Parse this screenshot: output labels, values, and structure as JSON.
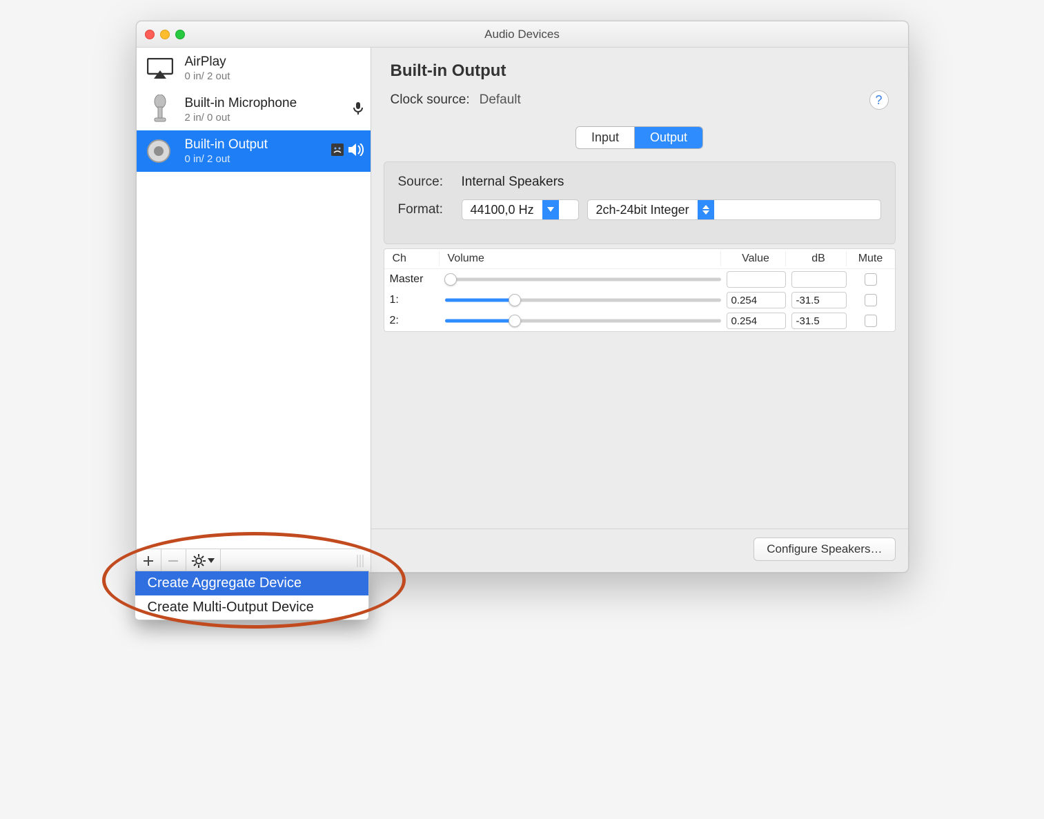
{
  "window": {
    "title": "Audio Devices"
  },
  "sidebar": {
    "devices": [
      {
        "name": "AirPlay",
        "sub": "0 in/ 2 out"
      },
      {
        "name": "Built-in Microphone",
        "sub": "2 in/ 0 out"
      },
      {
        "name": "Built-in Output",
        "sub": "0 in/ 2 out"
      }
    ],
    "popup": {
      "item0": "Create Aggregate Device",
      "item1": "Create Multi-Output Device"
    }
  },
  "main": {
    "title": "Built-in Output",
    "clock_label": "Clock source:",
    "clock_value": "Default",
    "tabs": {
      "input": "Input",
      "output": "Output"
    },
    "panel": {
      "source_label": "Source:",
      "source_value": "Internal Speakers",
      "format_label": "Format:",
      "rate": "44100,0 Hz",
      "depth": "2ch-24bit Integer"
    },
    "table": {
      "headers": {
        "ch": "Ch",
        "vol": "Volume",
        "val": "Value",
        "db": "dB",
        "mute": "Mute"
      },
      "rows": [
        {
          "ch": "Master",
          "value": "",
          "db": "",
          "pct": 0.02,
          "mutable": true,
          "enabled": false
        },
        {
          "ch": "1:",
          "value": "0.254",
          "db": "-31.5",
          "pct": 0.254,
          "mutable": true,
          "enabled": true
        },
        {
          "ch": "2:",
          "value": "0.254",
          "db": "-31.5",
          "pct": 0.254,
          "mutable": true,
          "enabled": true
        }
      ]
    },
    "configure_btn": "Configure Speakers…"
  }
}
